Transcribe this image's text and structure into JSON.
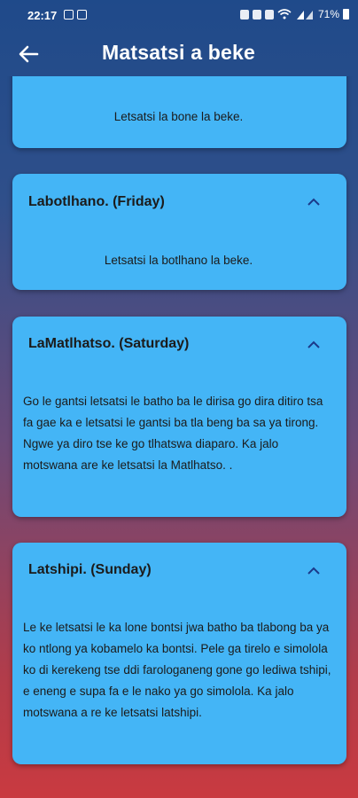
{
  "status": {
    "time": "22:17",
    "battery": "71%"
  },
  "header": {
    "title": "Matsatsi a beke"
  },
  "cards": [
    {
      "title": "",
      "text": "Letsatsi la bone la beke."
    },
    {
      "title": "Labotlhano. (Friday)",
      "text": "Letsatsi la botlhano la beke."
    },
    {
      "title": "LaMatlhatso. (Saturday)",
      "text": "Go le gantsi letsatsi le batho ba le dirisa go dira ditiro tsa fa gae ka e letsatsi le gantsi ba tla beng ba sa ya tirong. Ngwe ya diro tse ke go tlhatswa diaparo. Ka jalo motswana are ke letsatsi la Matlhatso. ."
    },
    {
      "title": "Latshipi. (Sunday)",
      "text": "Le ke letsatsi le ka lone bontsi jwa batho ba tlabong ba ya ko ntlong ya kobamelo ka bontsi. Pele ga tirelo e simolola ko di kerekeng tse ddi farologaneng gone go lediwa tshipi, e eneng e supa fa e le nako ya go simolola. Ka jalo motswana a re ke letsatsi latshipi."
    }
  ]
}
